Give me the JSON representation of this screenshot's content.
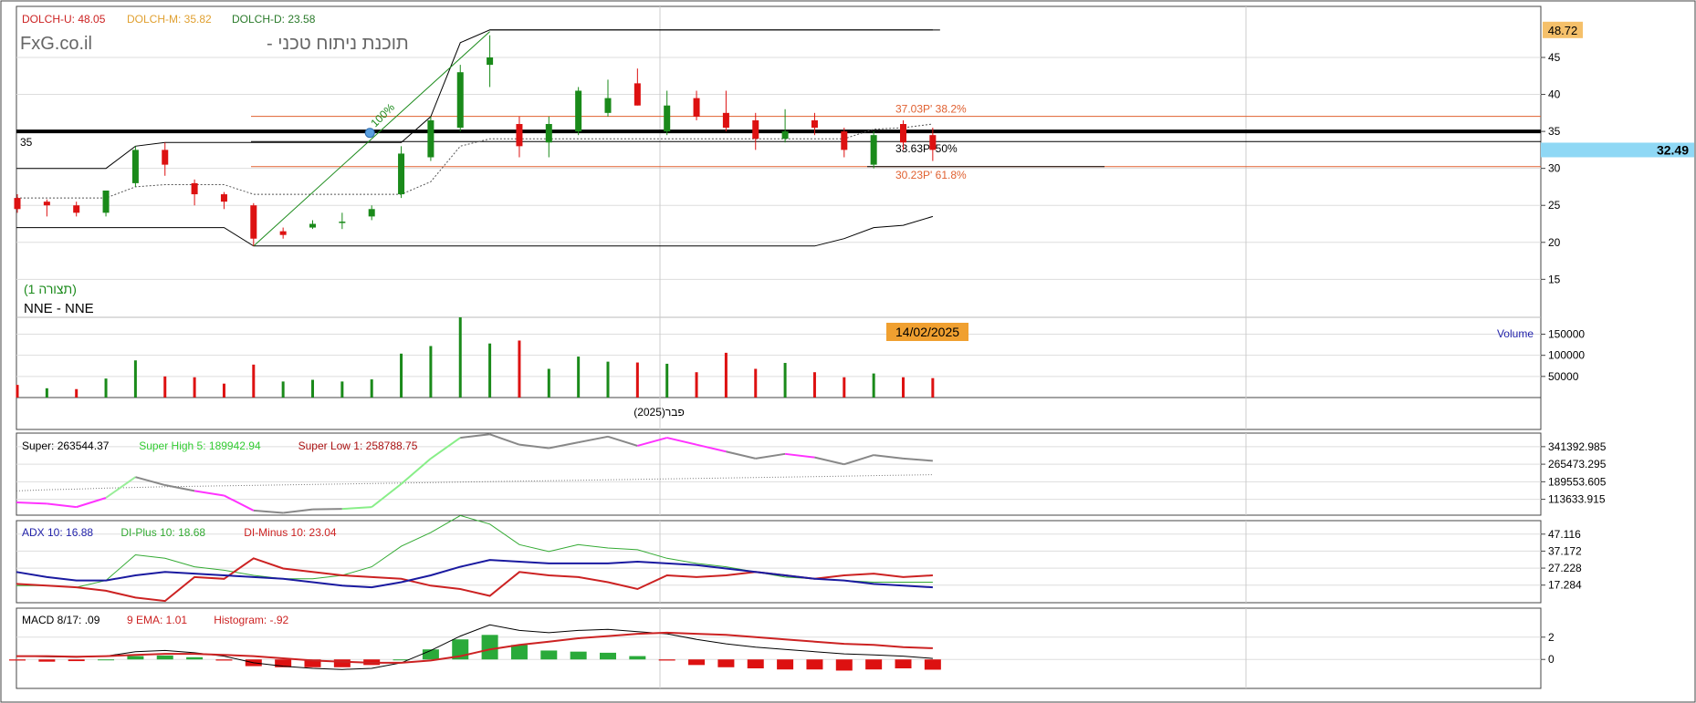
{
  "header": {
    "brand": "FxG.co.il",
    "brand_subtitle": "תוכנת ניתוח טכני -",
    "pattern_label": "(תצורה 1)",
    "symbol": "NNE - NNE",
    "date_badge": "14/02/2025",
    "x_month_label": "פבר(2025)"
  },
  "colors": {
    "up": "#1a8a1a",
    "down": "#dd1111",
    "fib": "#e06030",
    "price_badge": "#f5c06a",
    "current_price_badge": "#8fd8f5",
    "date_badge": "#f0a030"
  },
  "chart_data": [
    {
      "type": "candlestick",
      "name": "price-panel",
      "legend": [
        {
          "label": "DOLCH-U",
          "value": "48.05",
          "color": "#cc2222"
        },
        {
          "label": "DOLCH-M",
          "value": "35.82",
          "color": "#e0a030"
        },
        {
          "label": "DOLCH-D",
          "value": "23.58",
          "color": "#2a7a2a"
        }
      ],
      "y_ticks": [
        15,
        20,
        25,
        30,
        35,
        40,
        45
      ],
      "ylim": [
        12.7,
        50.3
      ],
      "last_high_label": "48.72",
      "current_price_label": "32.49",
      "horizontal_level": {
        "value": 35,
        "label": "35"
      },
      "fib_levels": [
        {
          "value": 37.03,
          "label": "37.03P' 38.2%",
          "color": "#e06030"
        },
        {
          "value": 33.63,
          "label": "33.63P' 50%",
          "color": "#000000"
        },
        {
          "value": 30.23,
          "label": "30.23P' 61.8%",
          "color": "#e06030"
        }
      ],
      "trendline_label": "100%",
      "candles": [
        {
          "o": 26.0,
          "h": 26.5,
          "l": 24.0,
          "c": 24.5
        },
        {
          "o": 25.5,
          "h": 25.8,
          "l": 23.5,
          "c": 25.0
        },
        {
          "o": 25.0,
          "h": 25.5,
          "l": 23.5,
          "c": 24.0
        },
        {
          "o": 24.0,
          "h": 27.0,
          "l": 23.5,
          "c": 27.0
        },
        {
          "o": 28.0,
          "h": 33.0,
          "l": 27.5,
          "c": 32.5
        },
        {
          "o": 32.5,
          "h": 33.5,
          "l": 29.0,
          "c": 30.5
        },
        {
          "o": 28.0,
          "h": 28.5,
          "l": 25.0,
          "c": 26.5
        },
        {
          "o": 26.5,
          "h": 26.8,
          "l": 24.5,
          "c": 25.5
        },
        {
          "o": 25.0,
          "h": 25.3,
          "l": 19.5,
          "c": 20.5
        },
        {
          "o": 21.5,
          "h": 22.0,
          "l": 20.5,
          "c": 21.0
        },
        {
          "o": 22.0,
          "h": 23.0,
          "l": 21.8,
          "c": 22.5
        },
        {
          "o": 22.8,
          "h": 24.0,
          "l": 21.8,
          "c": 22.8
        },
        {
          "o": 23.5,
          "h": 25.0,
          "l": 23.0,
          "c": 24.5
        },
        {
          "o": 26.5,
          "h": 33.0,
          "l": 26.0,
          "c": 32.0
        },
        {
          "o": 31.5,
          "h": 37.0,
          "l": 31.0,
          "c": 36.5
        },
        {
          "o": 35.5,
          "h": 44.0,
          "l": 35.0,
          "c": 43.0
        },
        {
          "o": 44.0,
          "h": 48.0,
          "l": 41.0,
          "c": 45.0
        },
        {
          "o": 36.0,
          "h": 37.0,
          "l": 31.5,
          "c": 33.0
        },
        {
          "o": 33.5,
          "h": 37.0,
          "l": 31.5,
          "c": 36.0
        },
        {
          "o": 35.0,
          "h": 41.0,
          "l": 34.5,
          "c": 40.5
        },
        {
          "o": 37.5,
          "h": 42.0,
          "l": 37.0,
          "c": 39.5
        },
        {
          "o": 41.5,
          "h": 43.5,
          "l": 38.5,
          "c": 38.5
        },
        {
          "o": 35.0,
          "h": 40.5,
          "l": 34.5,
          "c": 38.5
        },
        {
          "o": 39.5,
          "h": 40.5,
          "l": 36.5,
          "c": 37.0
        },
        {
          "o": 37.5,
          "h": 40.5,
          "l": 35.0,
          "c": 35.5
        },
        {
          "o": 36.5,
          "h": 37.5,
          "l": 32.5,
          "c": 34.0
        },
        {
          "o": 34.0,
          "h": 38.0,
          "l": 33.5,
          "c": 35.0
        },
        {
          "o": 36.5,
          "h": 37.5,
          "l": 34.5,
          "c": 35.5
        },
        {
          "o": 35.0,
          "h": 35.5,
          "l": 31.5,
          "c": 32.5
        },
        {
          "o": 30.5,
          "h": 35.0,
          "l": 30.0,
          "c": 34.5
        },
        {
          "o": 36.0,
          "h": 36.5,
          "l": 32.5,
          "c": 33.5
        },
        {
          "o": 34.5,
          "h": 35.5,
          "l": 31.0,
          "c": 32.5
        }
      ],
      "dolch_upper": [
        30,
        30,
        30,
        30,
        33,
        33.5,
        33.5,
        33.5,
        33.5,
        33.5,
        33.5,
        33.5,
        33.5,
        33.5,
        37,
        47,
        48.72,
        48.72,
        48.72,
        48.72,
        48.72,
        48.72,
        48.72,
        48.72,
        48.72,
        48.72,
        48.72,
        48.72,
        48.72,
        48.72,
        48.72,
        48.72
      ],
      "dolch_lower": [
        22,
        22,
        22,
        22,
        22,
        22,
        22,
        22,
        19.5,
        19.5,
        19.5,
        19.5,
        19.5,
        19.5,
        19.5,
        19.5,
        19.5,
        19.5,
        19.5,
        19.5,
        19.5,
        19.5,
        19.5,
        19.5,
        19.5,
        19.5,
        19.5,
        19.5,
        20.5,
        22,
        22.3,
        23.5
      ],
      "dolch_middle": [
        26,
        26,
        26,
        26,
        27.5,
        27.8,
        27.8,
        27.8,
        26.5,
        26.5,
        26.5,
        26.5,
        26.5,
        26.5,
        28.2,
        33,
        34,
        34,
        34,
        34,
        34,
        34,
        34,
        34,
        34,
        34,
        34,
        34,
        34,
        35.3,
        35.5,
        36
      ]
    },
    {
      "type": "bar",
      "name": "volume-panel",
      "title": "Volume",
      "y_ticks": [
        50000,
        100000,
        150000
      ],
      "y_tick_labels": [
        "50000",
        "100000",
        "150000"
      ],
      "ylim": [
        0,
        190000
      ],
      "values": [
        30000,
        22000,
        20000,
        45000,
        88000,
        50000,
        48000,
        33000,
        78000,
        38000,
        42000,
        38000,
        43000,
        104000,
        122000,
        190000,
        128000,
        135000,
        68000,
        97000,
        85000,
        83000,
        80000,
        60000,
        106000,
        68000,
        82000,
        60000,
        48000,
        57000,
        48000,
        46000
      ],
      "up": [
        false,
        true,
        false,
        true,
        true,
        false,
        false,
        false,
        false,
        true,
        true,
        true,
        true,
        true,
        true,
        true,
        true,
        false,
        true,
        true,
        true,
        false,
        true,
        false,
        false,
        false,
        true,
        false,
        false,
        true,
        false,
        false
      ]
    },
    {
      "type": "line",
      "name": "super-panel",
      "legend": [
        {
          "label": "Super",
          "value": "263544.37",
          "color": "#000000"
        },
        {
          "label": "Super High 5",
          "value": "189942.94",
          "color": "#33cc33"
        },
        {
          "label": "Super Low 1",
          "value": "258788.75",
          "color": "#aa1111"
        }
      ],
      "y_ticks": [
        113633.915,
        189553.605,
        265473.295,
        341392.985
      ],
      "y_tick_labels": [
        "113633.915",
        "189553.605",
        "265473.295",
        "341392.985"
      ],
      "ylim": [
        45000,
        400000
      ],
      "super_values": [
        100000,
        95000,
        80000,
        120000,
        210000,
        175000,
        150000,
        130000,
        65000,
        55000,
        70000,
        72000,
        80000,
        180000,
        290000,
        380000,
        395000,
        350000,
        335000,
        360000,
        385000,
        345000,
        380000,
        350000,
        320000,
        290000,
        310000,
        295000,
        265000,
        305000,
        290000,
        280000
      ],
      "super_segment_colors": [
        "#ff33ff",
        "#ff33ff",
        "#ff33ff",
        "#99ee99",
        "#888888",
        "#888888",
        "#ff33ff",
        "#ff33ff",
        "#888888",
        "#888888",
        "#888888",
        "#88ee88",
        "#88ee88",
        "#88ee88",
        "#88ee88",
        "#888888",
        "#888888",
        "#888888",
        "#888888",
        "#888888",
        "#888888",
        "#ff33ff",
        "#ff33ff",
        "#ff33ff",
        "#888888",
        "#888888",
        "#ff33ff",
        "#888888",
        "#888888",
        "#888888",
        "#888888"
      ],
      "reference_values": [
        150000,
        155000,
        158000,
        162000,
        165000,
        168000,
        170000,
        172000,
        174000,
        176000,
        178000,
        180000,
        182000,
        184000,
        186000,
        188000,
        190000,
        192000,
        194000,
        196000,
        198000,
        200000,
        202000,
        204000,
        206000,
        208000,
        210000,
        212000,
        214000,
        216000,
        218000,
        220000
      ]
    },
    {
      "type": "line",
      "name": "adx-panel",
      "legend": [
        {
          "label": "ADX 10",
          "value": "16.88",
          "color": "#2222aa"
        },
        {
          "label": "DI-Plus 10",
          "value": "18.68",
          "color": "#33aa33"
        },
        {
          "label": "DI-Minus 10",
          "value": "23.04",
          "color": "#cc2222"
        }
      ],
      "y_ticks": [
        17.284,
        27.228,
        37.172,
        47.116
      ],
      "y_tick_labels": [
        "17.284",
        "27.228",
        "37.172",
        "47.116"
      ],
      "ylim": [
        7,
        55
      ],
      "adx": [
        25,
        22,
        20,
        20,
        23,
        25,
        24,
        23,
        22,
        21,
        19,
        17,
        16,
        19,
        23,
        28,
        32,
        31,
        30,
        30,
        30,
        31,
        30,
        29,
        27,
        25,
        23,
        21,
        20,
        18,
        17,
        16
      ],
      "di_plus": [
        17,
        17,
        16,
        20,
        35,
        33,
        28,
        26,
        23,
        21,
        21,
        23,
        28,
        40,
        48,
        58,
        53,
        41,
        37,
        41,
        39,
        38,
        33,
        30,
        28,
        25,
        22,
        21,
        20,
        19,
        19,
        19
      ],
      "di_minus": [
        18,
        17,
        16,
        14,
        10,
        8,
        22,
        21,
        33,
        27,
        25,
        23,
        22,
        21,
        17,
        15,
        11,
        25,
        23,
        22,
        19,
        15,
        23,
        22,
        23,
        25,
        23,
        21,
        23,
        24,
        22,
        23
      ]
    },
    {
      "type": "bar",
      "name": "macd-panel",
      "legend": [
        {
          "label": "MACD 8/17",
          "value": ".09",
          "color": "#000000"
        },
        {
          "label": "9 EMA",
          "value": "1.01",
          "color": "#cc2222"
        },
        {
          "label": "Histogram",
          "value": "-.92",
          "color": "#cc2222"
        }
      ],
      "y_ticks": [
        0,
        2
      ],
      "y_tick_labels": [
        "0",
        "2"
      ],
      "ylim": [
        -2.6,
        4.6
      ],
      "macd": [
        0.3,
        0.25,
        0.2,
        0.3,
        0.7,
        0.8,
        0.6,
        0.3,
        -0.3,
        -0.6,
        -0.8,
        -0.9,
        -0.8,
        -0.3,
        0.8,
        2.1,
        3.1,
        2.6,
        2.4,
        2.6,
        2.7,
        2.5,
        2.3,
        1.8,
        1.4,
        1.1,
        0.9,
        0.7,
        0.5,
        0.4,
        0.3,
        0.09
      ],
      "signal": [
        0.3,
        0.3,
        0.25,
        0.3,
        0.4,
        0.5,
        0.5,
        0.4,
        0.3,
        0.1,
        -0.1,
        -0.2,
        -0.3,
        -0.3,
        -0.1,
        0.3,
        0.9,
        1.3,
        1.6,
        1.9,
        2.1,
        2.3,
        2.4,
        2.3,
        2.2,
        2.0,
        1.8,
        1.6,
        1.4,
        1.3,
        1.1,
        1.01
      ],
      "histogram": [
        -0.1,
        -0.2,
        -0.15,
        0.0,
        0.3,
        0.35,
        0.2,
        -0.1,
        -0.6,
        -0.7,
        -0.7,
        -0.7,
        -0.5,
        0.0,
        0.9,
        1.8,
        2.2,
        1.3,
        0.8,
        0.7,
        0.6,
        0.3,
        -0.1,
        -0.5,
        -0.7,
        -0.8,
        -0.9,
        -0.9,
        -1.0,
        -0.9,
        -0.8,
        -0.92
      ]
    }
  ]
}
